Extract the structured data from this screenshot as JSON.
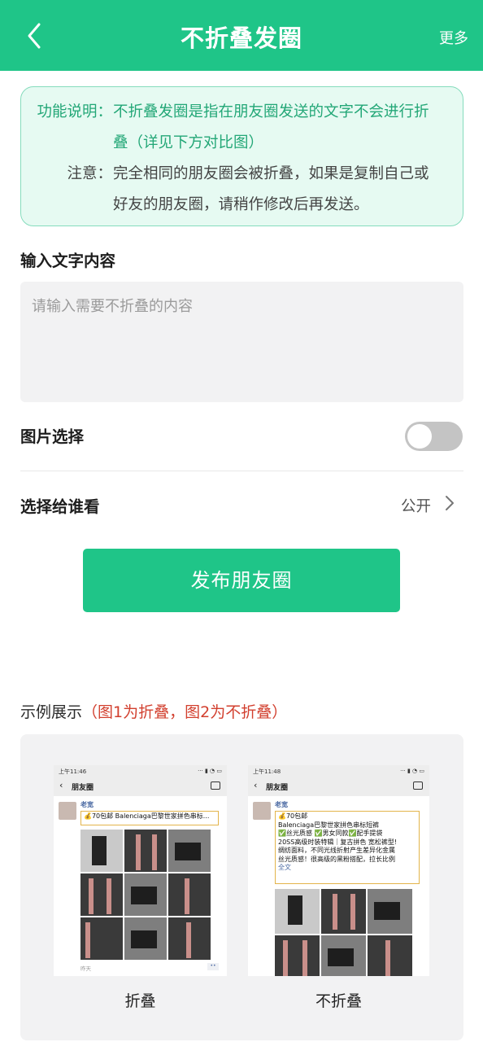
{
  "header": {
    "title": "不折叠发圈",
    "more_label": "更多"
  },
  "info": {
    "function_label": "功能说明：",
    "function_text_1": "不折叠发圈是指在朋友圈发送的文字不会进行折",
    "function_text_2": "叠（详见下方对比图）",
    "note_label": "注意：",
    "note_text_1": "完全相同的朋友圈会被折叠，如果是复制自己或",
    "note_text_2": "好友的朋友圈，请稍作修改后再发送。"
  },
  "input_section": {
    "title": "输入文字内容",
    "placeholder": "请输入需要不折叠的内容",
    "value": ""
  },
  "image_select": {
    "label": "图片选择",
    "enabled": false
  },
  "visibility": {
    "label": "选择给谁看",
    "value": "公开"
  },
  "publish_button": "发布朋友圈",
  "example": {
    "title": "示例展示",
    "note": "（图1为折叠，图2为不折叠）",
    "shots": [
      {
        "time": "上午11:46",
        "nav_title": "朋友圈",
        "user": "老宽",
        "text": "💰70包邮 Balenciaga巴黎世家拼色串标...",
        "footer": "昨天",
        "caption": "折叠"
      },
      {
        "time": "上午11:48",
        "nav_title": "朋友圈",
        "user": "老宽",
        "text_lines": [
          "💰70包邮",
          "Balenciaga巴黎世家拼色串标短裤",
          "✅丝光质感 ✅男女同款✅配手提袋",
          "20SS高级时装特辑｜复古拼色 宽松裤型!",
          "绸纺面料，不同光线折射产生差异化金属",
          "丝光质感！很高级的黑粉搭配，拉长比例"
        ],
        "full_text_label": "全文",
        "caption": "不折叠"
      }
    ]
  },
  "colors": {
    "brand": "#1fc588",
    "note_red": "#d23f2e",
    "info_bg": "#e6faf2"
  }
}
